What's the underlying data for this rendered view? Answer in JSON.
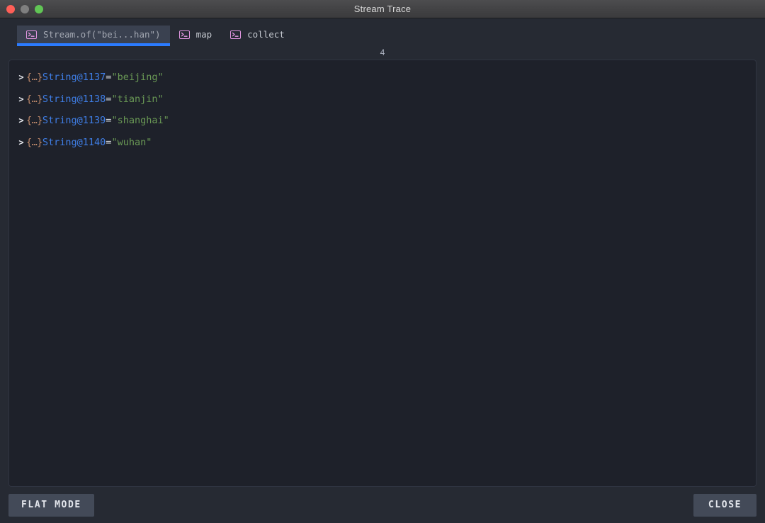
{
  "window": {
    "title": "Stream Trace",
    "traffic_lights": [
      {
        "name": "close",
        "color": "#ff5f57"
      },
      {
        "name": "minimize",
        "color": "#7f7f7f"
      },
      {
        "name": "maximize",
        "color": "#61c555"
      }
    ]
  },
  "tabs": [
    {
      "label": "Stream.of(\"bei...han\")",
      "icon": "console-icon",
      "active": true
    },
    {
      "label": "map",
      "icon": "console-icon",
      "active": false
    },
    {
      "label": "collect",
      "icon": "console-icon",
      "active": false
    }
  ],
  "count_label": "4",
  "rows": [
    {
      "chevron": ">",
      "brace": "{…}",
      "varname": "String@1137",
      "eq": "=",
      "value": "\"beijing\""
    },
    {
      "chevron": ">",
      "brace": "{…}",
      "varname": "String@1138",
      "eq": "=",
      "value": "\"tianjin\""
    },
    {
      "chevron": ">",
      "brace": "{…}",
      "varname": "String@1139",
      "eq": "=",
      "value": "\"shanghai\""
    },
    {
      "chevron": ">",
      "brace": "{…}",
      "varname": "String@1140",
      "eq": "=",
      "value": "\"wuhan\""
    }
  ],
  "footer": {
    "flat_mode_label": "FLAT MODE",
    "close_label": "CLOSE"
  },
  "colors": {
    "accent_underline": "#2b7bff",
    "icon_pink": "#e095e0",
    "varname_blue": "#3f7ee6",
    "string_green": "#6a9955",
    "brace_tan": "#c08a6b",
    "panel_bg": "#1e212a",
    "window_bg": "#262a33"
  }
}
